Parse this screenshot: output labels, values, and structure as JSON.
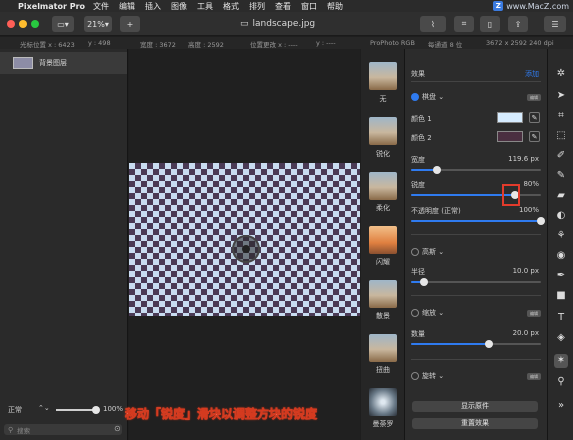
{
  "menubar": {
    "app_name": "Pixelmator Pro",
    "items": [
      "文件",
      "编辑",
      "插入",
      "图像",
      "工具",
      "格式",
      "排列",
      "查看",
      "窗口",
      "帮助"
    ],
    "watermark": "www.MacZ.com"
  },
  "toolbar": {
    "zoom": "21%",
    "add": "+",
    "doc_title": "landscape.jpg"
  },
  "infobar": {
    "cursor_x": "光标位置 x : 6423",
    "cursor_y": "y : 498",
    "width": "宽度 : 3672",
    "height": "高度 : 2592",
    "pos_change_x": "位置更改 x : ----",
    "pos_change_y": "y : ----",
    "color_profile": "ProPhoto RGB",
    "bit_depth": "每通道 8 位",
    "dimensions": "3672 x 2592 240 dpi"
  },
  "layers": {
    "layer_name": "背景图层",
    "blend_mode": "正常",
    "opacity": "100%",
    "search_placeholder": "搜索"
  },
  "thumbs": [
    {
      "label": "无"
    },
    {
      "label": "锐化"
    },
    {
      "label": "柔化"
    },
    {
      "label": "闪耀"
    },
    {
      "label": "散景"
    },
    {
      "label": "扭曲"
    },
    {
      "label": "曼荼罗"
    }
  ],
  "effects": {
    "header": "效果",
    "add": "添加",
    "checkerboard": "棋盘",
    "edit_badge": "编辑",
    "color1": "颜色 1",
    "color2": "颜色 2",
    "color1_hex": "#d6ecff",
    "color2_hex": "#4a2f40",
    "width_label": "宽度",
    "width_value": "119.6 px",
    "width_level": 0.2,
    "sharpness_label": "锐度",
    "sharpness_value": "80%",
    "sharpness_level": 0.8,
    "opacity_label": "不透明度 (正常)",
    "opacity_value": "100%",
    "opacity_level": 1.0,
    "highlights": "高斯",
    "radius_label": "半径",
    "radius_value": "10.0 px",
    "radius_level": 0.1,
    "zoom_label": "缩放",
    "count_label": "数量",
    "count_value": "20.0 px",
    "count_level": 0.6,
    "rotate_label": "旋转",
    "show_original": "显示原件",
    "reset_effects": "重置效果"
  },
  "caption": "移动「锐度」滑块以调整方块的锐度"
}
